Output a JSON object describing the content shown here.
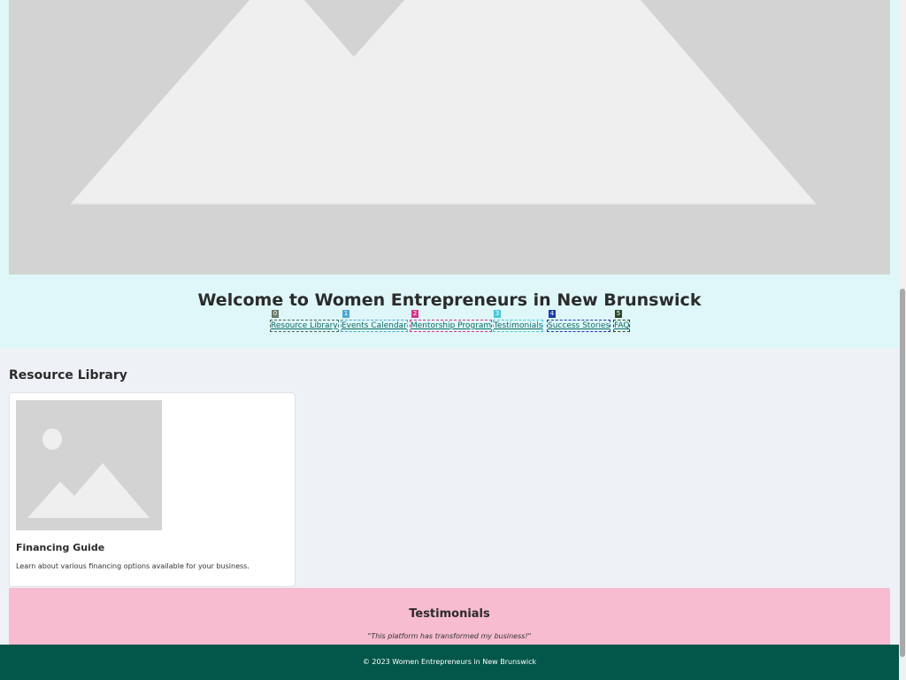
{
  "header": {
    "hero_image_icon": "image-placeholder-icon",
    "title": "Welcome to Women Entrepreneurs in New Brunswick",
    "nav": [
      {
        "label": "Resource Library",
        "badge": "0",
        "badge_color": "#6b7b6b",
        "border_color": "#4a6a5a"
      },
      {
        "label": "Events Calendar",
        "badge": "1",
        "badge_color": "#4aa8d8",
        "border_color": "#4aa8d8"
      },
      {
        "label": "Mentorship Program",
        "badge": "2",
        "badge_color": "#d8328c",
        "border_color": "#d8328c"
      },
      {
        "label": "Testimonials",
        "badge": "3",
        "badge_color": "#4ac8d8",
        "border_color": "#4ac8d8"
      },
      {
        "label": "Success Stories",
        "badge": "4",
        "badge_color": "#1a3ab8",
        "border_color": "#1a3ab8"
      },
      {
        "label": "FAQ",
        "badge": "5",
        "badge_color": "#2a4a2a",
        "border_color": "#2a4a2a"
      }
    ]
  },
  "resources": {
    "title": "Resource Library",
    "card": {
      "image_icon": "image-placeholder-icon",
      "title": "Financing Guide",
      "description": "Learn about various financing options available for your business."
    }
  },
  "testimonials": {
    "title": "Testimonials",
    "quote": "\"This platform has transformed my business!\""
  },
  "footer": {
    "text": "© 2023 Women Entrepreneurs in New Brunswick"
  },
  "colors": {
    "header_bg": "#dff7f8",
    "testimonials_bg": "#f7bcd0",
    "footer_bg": "#03574a",
    "link": "#0d6b66"
  }
}
